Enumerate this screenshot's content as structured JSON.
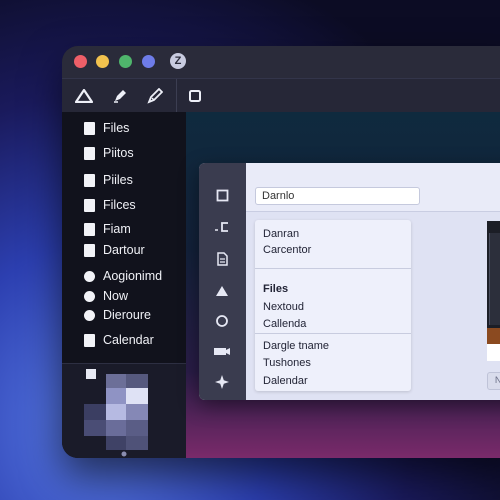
{
  "window": {
    "logo_text": "Z"
  },
  "sidebar": {
    "items": [
      {
        "label": "Files",
        "icon": "file-icon"
      },
      {
        "label": "Piitos",
        "icon": "file-icon"
      },
      {
        "label": "Piiles",
        "icon": "file-icon"
      },
      {
        "label": "Filces",
        "icon": "file-icon"
      },
      {
        "label": "Fiam",
        "icon": "file-icon"
      },
      {
        "label": "Dartour",
        "icon": "file-icon"
      },
      {
        "label": "Aogionimd",
        "icon": "circle-icon"
      },
      {
        "label": "Now",
        "icon": "circle-icon"
      },
      {
        "label": "Dieroure",
        "icon": "circle-icon"
      },
      {
        "label": "Calendar",
        "icon": "file-icon"
      }
    ]
  },
  "panel": {
    "search_value": "Darnlo",
    "list": {
      "group1": [
        "Danran",
        "Carcentor"
      ],
      "group2_heading": "Files",
      "group2": [
        "Nextoud",
        "Callenda"
      ],
      "group3": [
        "Dargle tname",
        "Tushones",
        "Dalendar"
      ]
    },
    "next_button_label": "Nexclubcds)"
  },
  "colors": {
    "accent": "#2c3fb0",
    "panel_bg": "#dfe2f3",
    "rail": "#3a3c4f"
  }
}
